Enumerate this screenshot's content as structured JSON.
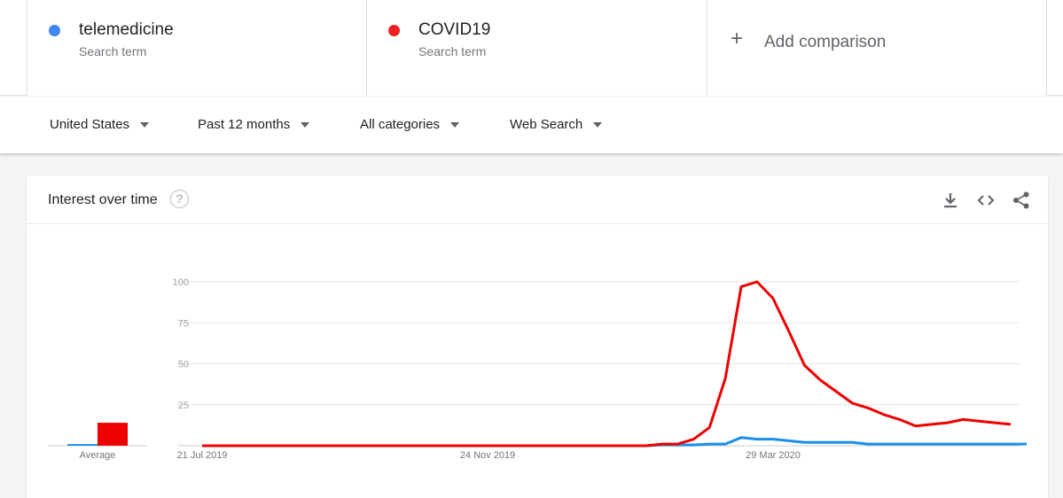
{
  "terms": [
    {
      "name": "telemedicine",
      "sub": "Search term",
      "color": "#4285f4"
    },
    {
      "name": "COVID19",
      "sub": "Search term",
      "color": "#ee2222"
    }
  ],
  "add_comparison": {
    "label": "Add comparison"
  },
  "filters": [
    {
      "label": "United States"
    },
    {
      "label": "Past 12 months"
    },
    {
      "label": "All categories"
    },
    {
      "label": "Web Search"
    }
  ],
  "panel": {
    "title": "Interest over time",
    "help_icon": "help-circle-icon",
    "tools": [
      "download-icon",
      "embed-code-icon",
      "share-icon"
    ]
  },
  "chart_data": {
    "type": "line",
    "x_tick_labels": [
      "21 Jul 2019",
      "24 Nov 2019",
      "29 Mar 2020"
    ],
    "y_ticks": [
      25,
      50,
      75,
      100
    ],
    "ylim": [
      0,
      100
    ],
    "grid": true,
    "series": [
      {
        "name": "telemedicine",
        "color": "#1a8fe8",
        "values": [
          0,
          0,
          0,
          0,
          0,
          0,
          0,
          0,
          0,
          0,
          0,
          0,
          0,
          0,
          0,
          0,
          0,
          0,
          0,
          0,
          0,
          0,
          0,
          0,
          0,
          0,
          0,
          0,
          0,
          0.5,
          0.5,
          0.5,
          1,
          1,
          5,
          4,
          4,
          3,
          2,
          2,
          2,
          2,
          1,
          1,
          1,
          1,
          1,
          1,
          1,
          1,
          1,
          1,
          1
        ]
      },
      {
        "name": "COVID19",
        "color": "#ee0000",
        "values": [
          0,
          0,
          0,
          0,
          0,
          0,
          0,
          0,
          0,
          0,
          0,
          0,
          0,
          0,
          0,
          0,
          0,
          0,
          0,
          0,
          0,
          0,
          0,
          0,
          0,
          0,
          0,
          0,
          0,
          1,
          1,
          4,
          11,
          41,
          97,
          100,
          90,
          70,
          49,
          40,
          33,
          26,
          23,
          19,
          16,
          12,
          13,
          14,
          16,
          15,
          14,
          13
        ]
      }
    ],
    "average": {
      "label": "Average",
      "values": [
        {
          "term": "telemedicine",
          "value": 1,
          "color": "#1a8fe8"
        },
        {
          "term": "COVID19",
          "value": 14,
          "color": "#ee0000"
        }
      ]
    }
  }
}
